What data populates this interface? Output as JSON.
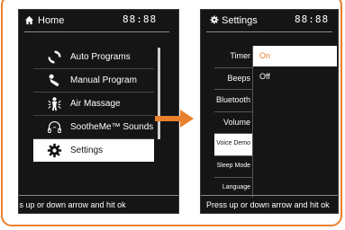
{
  "colors": {
    "accent": "#e8802c",
    "screen_bg": "#151515",
    "selected_bg": "#ffffff",
    "selected_option_text": "#e8802c"
  },
  "left_screen": {
    "home_icon": "home-icon",
    "title": "Home",
    "clock": "88:88",
    "menu": [
      {
        "label": "Auto Programs",
        "icon": "circular-arrows-icon"
      },
      {
        "label": "Manual Program",
        "icon": "hand-icon"
      },
      {
        "label": "Air Massage",
        "icon": "air-figure-icon"
      },
      {
        "label": "SootheMe™ Sounds",
        "icon": "headphones-icon"
      },
      {
        "label": "Settings",
        "icon": "gear-icon",
        "selected": true
      }
    ],
    "hint": "Press up or down arrow and hit ok"
  },
  "arrow_icon": "right-arrow-icon",
  "right_screen": {
    "gear_icon": "gear-icon",
    "title": "Settings",
    "clock": "88:88",
    "menu": [
      {
        "label": "Timer"
      },
      {
        "label": "Beeps"
      },
      {
        "label": "Bluetooth"
      },
      {
        "label": "Volume"
      },
      {
        "label": "Voice Demo",
        "selected": true
      },
      {
        "label": "Sleep Mode"
      },
      {
        "label": "Language"
      }
    ],
    "options": [
      {
        "label": "On",
        "selected": true
      },
      {
        "label": "Off"
      }
    ],
    "hint": "Press up or down arrow and hit ok"
  }
}
